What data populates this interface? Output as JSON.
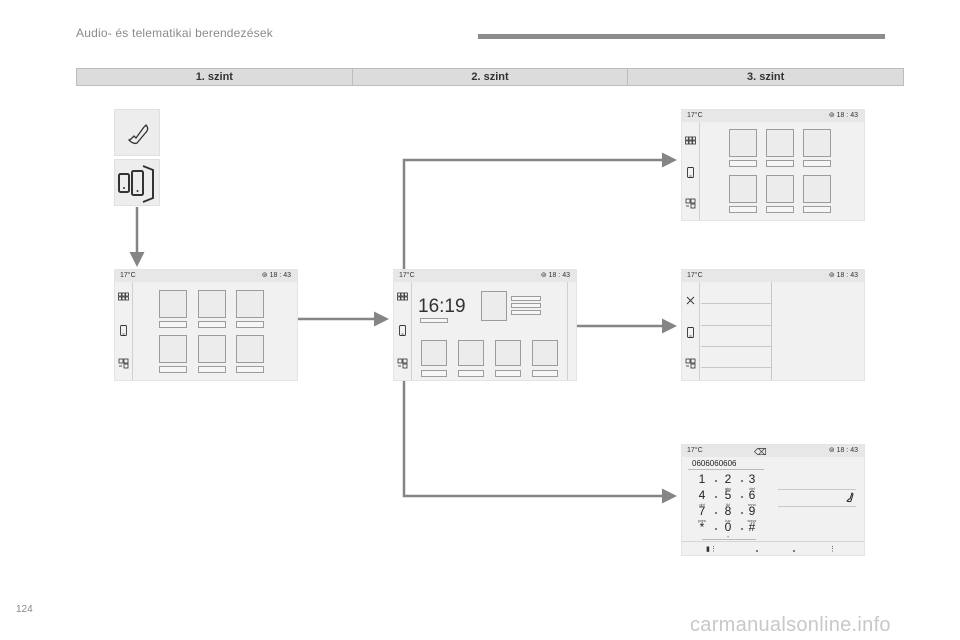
{
  "header": {
    "title": "Audio- és telematikai berendezések"
  },
  "levels": [
    "1. szint",
    "2. szint",
    "3. szint"
  ],
  "status": {
    "temp": "17°C",
    "time": "18 : 43",
    "clock_icon": "clock-icon"
  },
  "level2_clock": "16:19",
  "dialer": {
    "number": "0606060606",
    "keys": [
      {
        "digit": "1",
        "sub": ""
      },
      {
        "digit": "2",
        "sub": "abc"
      },
      {
        "digit": "3",
        "sub": "def"
      },
      {
        "digit": "4",
        "sub": "ghi"
      },
      {
        "digit": "5",
        "sub": "jkl"
      },
      {
        "digit": "6",
        "sub": "mno"
      },
      {
        "digit": "7",
        "sub": "pqrs"
      },
      {
        "digit": "8",
        "sub": "tuv"
      },
      {
        "digit": "9",
        "sub": "wxyz"
      },
      {
        "digit": "*",
        "sub": ""
      },
      {
        "digit": "0",
        "sub": "+"
      },
      {
        "digit": "#",
        "sub": ""
      }
    ]
  },
  "page_number": "124",
  "watermark": "carmanualsonline.info",
  "colors": {
    "arrow": "#858585",
    "screen_bg": "#f1f1f1",
    "bar": "#dcdcdc"
  }
}
